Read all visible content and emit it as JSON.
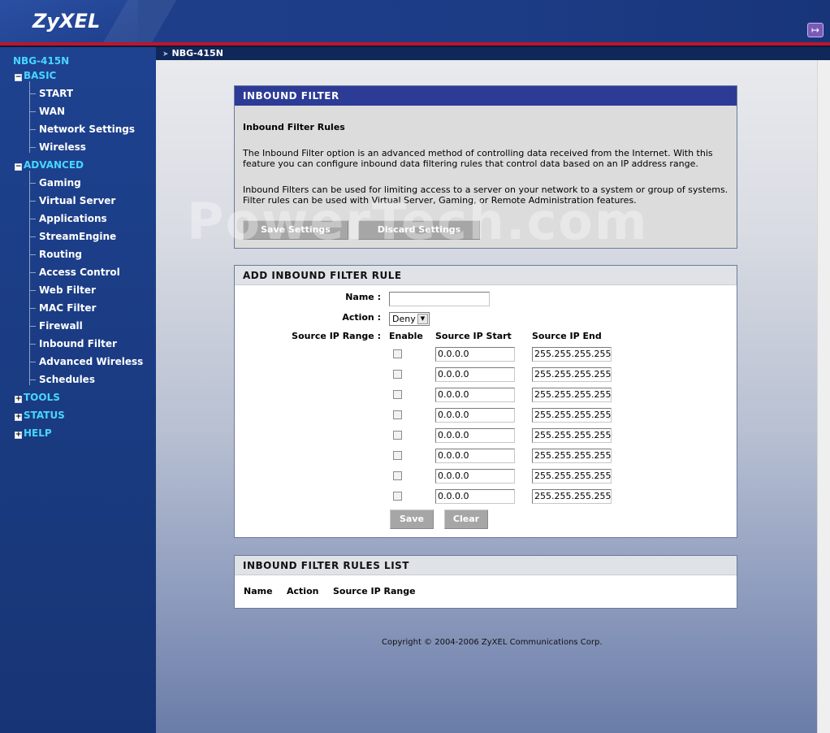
{
  "header": {
    "logo": "ZyXEL",
    "logout_icon": "logout-icon"
  },
  "titlebar": {
    "title": "NBG-415N"
  },
  "sidebar": {
    "model": "NBG-415N",
    "groups": [
      {
        "label": "BASIC",
        "expander": "−",
        "items": [
          "START",
          "WAN",
          "Network Settings",
          "Wireless"
        ]
      },
      {
        "label": "ADVANCED",
        "expander": "−",
        "items": [
          "Gaming",
          "Virtual Server",
          "Applications",
          "StreamEngine",
          "Routing",
          "Access Control",
          "Web Filter",
          "MAC Filter",
          "Firewall",
          "Inbound Filter",
          "Advanced Wireless",
          "Schedules"
        ]
      },
      {
        "label": "TOOLS",
        "expander": "+"
      },
      {
        "label": "STATUS",
        "expander": "+"
      },
      {
        "label": "HELP",
        "expander": "+"
      }
    ]
  },
  "watermark": "PowerTech.com",
  "inbound_filter": {
    "title": "INBOUND FILTER",
    "subtitle": "Inbound Filter Rules",
    "para1": "The Inbound Filter option is an advanced method of controlling data received from the Internet. With this feature you can configure inbound data filtering rules that control data based on an IP address range.",
    "para2": "Inbound Filters can be used for limiting access to a server on your network to a system or group of systems. Filter rules can be used with Virtual Server, Gaming, or Remote Administration features.",
    "save_label": "Save Settings",
    "discard_label": "Discard Settings"
  },
  "add_rule": {
    "title": "ADD INBOUND FILTER RULE",
    "name_label": "Name :",
    "name_value": "",
    "action_label": "Action :",
    "action_value": "Deny",
    "range_label": "Source IP Range :",
    "col_enable": "Enable",
    "col_start": "Source IP Start",
    "col_end": "Source IP End",
    "rows": [
      {
        "start": "0.0.0.0",
        "end": "255.255.255.255"
      },
      {
        "start": "0.0.0.0",
        "end": "255.255.255.255"
      },
      {
        "start": "0.0.0.0",
        "end": "255.255.255.255"
      },
      {
        "start": "0.0.0.0",
        "end": "255.255.255.255"
      },
      {
        "start": "0.0.0.0",
        "end": "255.255.255.255"
      },
      {
        "start": "0.0.0.0",
        "end": "255.255.255.255"
      },
      {
        "start": "0.0.0.0",
        "end": "255.255.255.255"
      },
      {
        "start": "0.0.0.0",
        "end": "255.255.255.255"
      }
    ],
    "save_label": "Save",
    "clear_label": "Clear"
  },
  "rules_list": {
    "title": "INBOUND FILTER RULES LIST",
    "col_name": "Name",
    "col_action": "Action",
    "col_range": "Source IP Range"
  },
  "copyright": "Copyright © 2004-2006 ZyXEL Communications Corp."
}
